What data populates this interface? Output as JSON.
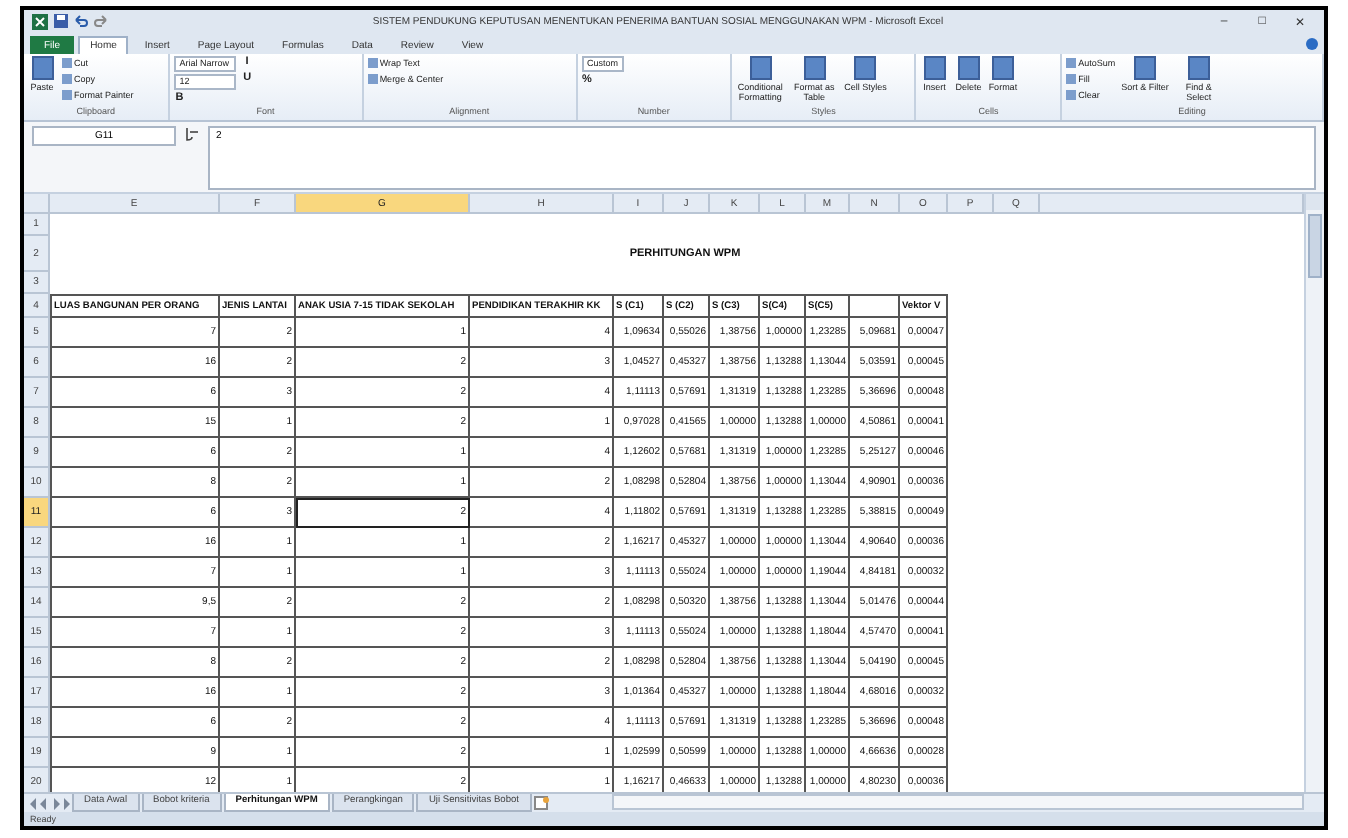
{
  "window": {
    "title": "SISTEM PENDUKUNG KEPUTUSAN MENENTUKAN PENERIMA BANTUAN SOSIAL MENGGUNAKAN WPM - Microsoft Excel",
    "controls": [
      "–",
      "□",
      "✕"
    ]
  },
  "menu_tabs": [
    {
      "label": "File",
      "kind": "file",
      "selected": false
    },
    {
      "label": "Home",
      "kind": "tab",
      "selected": true
    },
    {
      "label": "Insert",
      "kind": "tab",
      "selected": false
    },
    {
      "label": "Page Layout",
      "kind": "tab",
      "selected": false
    },
    {
      "label": "Formulas",
      "kind": "tab",
      "selected": false
    },
    {
      "label": "Data",
      "kind": "tab",
      "selected": false
    },
    {
      "label": "Review",
      "kind": "tab",
      "selected": false
    },
    {
      "label": "View",
      "kind": "tab",
      "selected": false
    }
  ],
  "ribbon": {
    "groups": [
      {
        "label": "Clipboard",
        "items": [
          {
            "label": "Paste",
            "kind": "large"
          },
          {
            "label": "Cut",
            "kind": "small"
          },
          {
            "label": "Copy",
            "kind": "small"
          },
          {
            "label": "Format Painter",
            "kind": "small"
          }
        ]
      },
      {
        "label": "Font",
        "items": [
          {
            "label": "Arial Narrow",
            "kind": "field"
          },
          {
            "label": "12",
            "kind": "field"
          },
          {
            "label": "B",
            "kind": "glyph"
          },
          {
            "label": "I",
            "kind": "glyph"
          },
          {
            "label": "U",
            "kind": "glyph"
          }
        ]
      },
      {
        "label": "Alignment",
        "items": [
          {
            "label": "Wrap Text",
            "kind": "small"
          },
          {
            "label": "Merge & Center",
            "kind": "small"
          }
        ]
      },
      {
        "label": "Number",
        "items": [
          {
            "label": "Custom",
            "kind": "field"
          },
          {
            "label": "%",
            "kind": "glyph"
          }
        ]
      },
      {
        "label": "Styles",
        "items": [
          {
            "label": "Conditional Formatting",
            "kind": "large"
          },
          {
            "label": "Format as Table",
            "kind": "large"
          },
          {
            "label": "Cell Styles",
            "kind": "large"
          }
        ]
      },
      {
        "label": "Cells",
        "items": [
          {
            "label": "Insert",
            "kind": "large"
          },
          {
            "label": "Delete",
            "kind": "large"
          },
          {
            "label": "Format",
            "kind": "large"
          }
        ]
      },
      {
        "label": "Editing",
        "items": [
          {
            "label": "AutoSum",
            "kind": "small"
          },
          {
            "label": "Fill",
            "kind": "small"
          },
          {
            "label": "Clear",
            "kind": "small"
          },
          {
            "label": "Sort & Filter",
            "kind": "large"
          },
          {
            "label": "Find & Select",
            "kind": "large"
          }
        ]
      }
    ]
  },
  "formula_bar": {
    "name_box": "G11",
    "formula": "2"
  },
  "sheet": {
    "columns": [
      {
        "label": "E",
        "selected": false
      },
      {
        "label": "F",
        "selected": false
      },
      {
        "label": "G",
        "selected": true
      },
      {
        "label": "H",
        "selected": false
      },
      {
        "label": "I",
        "selected": false
      },
      {
        "label": "J",
        "selected": false
      },
      {
        "label": "K",
        "selected": false
      },
      {
        "label": "L",
        "selected": false
      },
      {
        "label": "M",
        "selected": false
      },
      {
        "label": "N",
        "selected": false
      },
      {
        "label": "O",
        "selected": false
      },
      {
        "label": "P",
        "selected": false
      },
      {
        "label": "Q",
        "selected": false
      }
    ],
    "rows": [
      {
        "number": "1",
        "selected": false
      },
      {
        "number": "2",
        "selected": false,
        "title": "PERHITUNGAN WPM"
      },
      {
        "number": "3",
        "selected": false
      },
      {
        "number": "4",
        "selected": false,
        "headers": [
          "LUAS BANGUNAN PER ORANG",
          "JENIS LANTAI",
          "ANAK USIA 7-15 TIDAK SEKOLAH",
          "PENDIDIKAN TERAKHIR KK",
          "S (C1)",
          "S (C2)",
          "S (C3)",
          "S(C4)",
          "S(C5)"
        ],
        "vector_header": "Vektor V"
      },
      {
        "number": "5",
        "selected": false,
        "cells": [
          "7",
          "2",
          "1",
          "4",
          "1,09634",
          "0,55026",
          "1,38756",
          "1,00000",
          "1,23285",
          "5,09681",
          "0,00047"
        ]
      },
      {
        "number": "6",
        "selected": false,
        "cells": [
          "16",
          "2",
          "2",
          "3",
          "1,04527",
          "0,45327",
          "1,38756",
          "1,13288",
          "1,13044",
          "5,03591",
          "0,00045"
        ]
      },
      {
        "number": "7",
        "selected": false,
        "cells": [
          "6",
          "3",
          "2",
          "4",
          "1,11113",
          "0,57691",
          "1,31319",
          "1,13288",
          "1,23285",
          "5,36696",
          "0,00048"
        ]
      },
      {
        "number": "8",
        "selected": false,
        "cells": [
          "15",
          "1",
          "2",
          "1",
          "0,97028",
          "0,41565",
          "1,00000",
          "1,13288",
          "1,00000",
          "4,50861",
          "0,00041"
        ]
      },
      {
        "number": "9",
        "selected": false,
        "cells": [
          "6",
          "2",
          "1",
          "4",
          "1,12602",
          "0,57681",
          "1,31319",
          "1,00000",
          "1,23285",
          "5,25127",
          "0,00046"
        ]
      },
      {
        "number": "10",
        "selected": false,
        "cells": [
          "8",
          "2",
          "1",
          "2",
          "1,08298",
          "0,52804",
          "1,38756",
          "1,00000",
          "1,13044",
          "4,90901",
          "0,00036"
        ]
      },
      {
        "number": "11",
        "selected": true,
        "cells": [
          "6",
          "3",
          "2",
          "4",
          "1,11802",
          "0,57691",
          "1,31319",
          "1,13288",
          "1,23285",
          "5,38815",
          "0,00049"
        ]
      },
      {
        "number": "12",
        "selected": false,
        "cells": [
          "16",
          "1",
          "1",
          "2",
          "1,16217",
          "0,45327",
          "1,00000",
          "1,00000",
          "1,13044",
          "4,90640",
          "0,00036"
        ]
      },
      {
        "number": "13",
        "selected": false,
        "cells": [
          "7",
          "1",
          "1",
          "3",
          "1,11113",
          "0,55024",
          "1,00000",
          "1,00000",
          "1,19044",
          "4,84181",
          "0,00032"
        ]
      },
      {
        "number": "14",
        "selected": false,
        "cells": [
          "9,5",
          "2",
          "2",
          "2",
          "1,08298",
          "0,50320",
          "1,38756",
          "1,13288",
          "1,13044",
          "5,01476",
          "0,00044"
        ]
      },
      {
        "number": "15",
        "selected": false,
        "cells": [
          "7",
          "1",
          "2",
          "3",
          "1,11113",
          "0,55024",
          "1,00000",
          "1,13288",
          "1,18044",
          "4,57470",
          "0,00041"
        ]
      },
      {
        "number": "16",
        "selected": false,
        "cells": [
          "8",
          "2",
          "2",
          "2",
          "1,08298",
          "0,52804",
          "1,38756",
          "1,13288",
          "1,13044",
          "5,04190",
          "0,00045"
        ]
      },
      {
        "number": "17",
        "selected": false,
        "cells": [
          "16",
          "1",
          "2",
          "3",
          "1,01364",
          "0,45327",
          "1,00000",
          "1,13288",
          "1,18044",
          "4,68016",
          "0,00032"
        ]
      },
      {
        "number": "18",
        "selected": false,
        "cells": [
          "6",
          "2",
          "2",
          "4",
          "1,11113",
          "0,57691",
          "1,31319",
          "1,13288",
          "1,23285",
          "5,36696",
          "0,00048"
        ]
      },
      {
        "number": "19",
        "selected": false,
        "cells": [
          "9",
          "1",
          "2",
          "1",
          "1,02599",
          "0,50599",
          "1,00000",
          "1,13288",
          "1,00000",
          "4,66636",
          "0,00028"
        ]
      },
      {
        "number": "20",
        "selected": false,
        "cells": [
          "12",
          "1",
          "2",
          "1",
          "1,16217",
          "0,46633",
          "1,00000",
          "1,13288",
          "1,00000",
          "4,80230",
          "0,00036"
        ]
      }
    ]
  },
  "sheet_tabs": [
    {
      "label": "Data Awal",
      "selected": false
    },
    {
      "label": "Bobot kriteria",
      "selected": false
    },
    {
      "label": "Perhitungan WPM",
      "selected": true
    },
    {
      "label": "Perangkingan",
      "selected": false
    },
    {
      "label": "Uji Sensitivitas Bobot",
      "selected": false
    }
  ],
  "status_bar": {
    "text": "Ready"
  }
}
